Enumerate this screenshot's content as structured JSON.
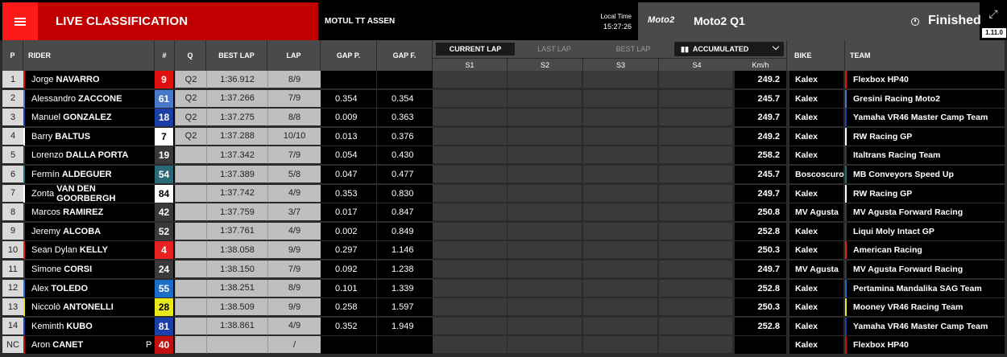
{
  "header": {
    "title": "LIVE CLASSIFICATION",
    "event": "MOTUL TT ASSEN",
    "local_time_label": "Local Time",
    "local_time": "15:27:26",
    "series_logo": "Moto2",
    "session": "Moto2 Q1",
    "status": "Finished",
    "version": "1.11.0"
  },
  "columns": {
    "pos": "P",
    "rider": "RIDER",
    "num": "#",
    "q": "Q",
    "best_lap": "BEST LAP",
    "lap": "LAP",
    "gap_p": "GAP P.",
    "gap_f": "GAP F.",
    "s1": "S1",
    "s2": "S2",
    "s3": "S3",
    "s4": "S4",
    "kmh": "Km/h",
    "bike": "BIKE",
    "team": "TEAM"
  },
  "tabs": [
    "CURRENT LAP",
    "LAST LAP",
    "BEST LAP"
  ],
  "mode_select": "ACCUMULATED",
  "rows": [
    {
      "pos": "1",
      "first": "Jorge",
      "last": "NAVARRO",
      "num": "9",
      "num_bg": "#e01010",
      "num_fg": "#ffffff",
      "accent": "#e01010",
      "q": "Q2",
      "best": "1:36.912",
      "lap": "8/9",
      "gap_p": "",
      "gap_f": "",
      "kmh": "249.2",
      "bike": "Kalex",
      "team": "Flexbox HP40",
      "flag": ""
    },
    {
      "pos": "2",
      "first": "Alessandro",
      "last": "ZACCONE",
      "num": "61",
      "num_bg": "#4a78c8",
      "num_fg": "#ffffff",
      "accent": "#4a78c8",
      "q": "Q2",
      "best": "1:37.266",
      "lap": "7/9",
      "gap_p": "0.354",
      "gap_f": "0.354",
      "kmh": "245.7",
      "bike": "Kalex",
      "team": "Gresini Racing Moto2",
      "flag": ""
    },
    {
      "pos": "3",
      "first": "Manuel",
      "last": "GONZALEZ",
      "num": "18",
      "num_bg": "#1a3fa8",
      "num_fg": "#ffffff",
      "accent": "#1a3fa8",
      "q": "Q2",
      "best": "1:37.275",
      "lap": "8/8",
      "gap_p": "0.009",
      "gap_f": "0.363",
      "kmh": "249.7",
      "bike": "Kalex",
      "team": "Yamaha VR46 Master Camp Team",
      "flag": ""
    },
    {
      "pos": "4",
      "first": "Barry",
      "last": "BALTUS",
      "num": "7",
      "num_bg": "#ffffff",
      "num_fg": "#000000",
      "accent": "#ffffff",
      "q": "Q2",
      "best": "1:37.288",
      "lap": "10/10",
      "gap_p": "0.013",
      "gap_f": "0.376",
      "kmh": "249.2",
      "bike": "Kalex",
      "team": "RW Racing GP",
      "flag": ""
    },
    {
      "pos": "5",
      "first": "Lorenzo",
      "last": "DALLA PORTA",
      "num": "19",
      "num_bg": "#3a3a3a",
      "num_fg": "#ffffff",
      "accent": "#3a3a3a",
      "q": "",
      "best": "1:37.342",
      "lap": "7/9",
      "gap_p": "0.054",
      "gap_f": "0.430",
      "kmh": "258.2",
      "bike": "Kalex",
      "team": "Italtrans Racing Team",
      "flag": ""
    },
    {
      "pos": "6",
      "first": "Fermín",
      "last": "ALDEGUER",
      "num": "54",
      "num_bg": "#2a6a78",
      "num_fg": "#ffffff",
      "accent": "#2a6a78",
      "q": "",
      "best": "1:37.389",
      "lap": "5/8",
      "gap_p": "0.047",
      "gap_f": "0.477",
      "kmh": "245.7",
      "bike": "Boscoscuro",
      "team": "MB Conveyors Speed Up",
      "flag": ""
    },
    {
      "pos": "7",
      "first": "Zonta",
      "last": "VAN DEN GOORBERGH",
      "num": "84",
      "num_bg": "#ffffff",
      "num_fg": "#000000",
      "accent": "#ffffff",
      "q": "",
      "best": "1:37.742",
      "lap": "4/9",
      "gap_p": "0.353",
      "gap_f": "0.830",
      "kmh": "249.7",
      "bike": "Kalex",
      "team": "RW Racing GP",
      "flag": ""
    },
    {
      "pos": "8",
      "first": "Marcos",
      "last": "RAMIREZ",
      "num": "42",
      "num_bg": "#3a3a3a",
      "num_fg": "#ffffff",
      "accent": "#3a3a3a",
      "q": "",
      "best": "1:37.759",
      "lap": "3/7",
      "gap_p": "0.017",
      "gap_f": "0.847",
      "kmh": "250.8",
      "bike": "MV Agusta",
      "team": "MV Agusta Forward Racing",
      "flag": ""
    },
    {
      "pos": "9",
      "first": "Jeremy",
      "last": "ALCOBA",
      "num": "52",
      "num_bg": "#3a3a3a",
      "num_fg": "#ffffff",
      "accent": "#3a3a3a",
      "q": "",
      "best": "1:37.761",
      "lap": "4/9",
      "gap_p": "0.002",
      "gap_f": "0.849",
      "kmh": "252.8",
      "bike": "Kalex",
      "team": "Liqui Moly Intact GP",
      "flag": ""
    },
    {
      "pos": "10",
      "first": "Sean Dylan",
      "last": "KELLY",
      "num": "4",
      "num_bg": "#e82020",
      "num_fg": "#ffffff",
      "accent": "#e82020",
      "q": "",
      "best": "1:38.058",
      "lap": "9/9",
      "gap_p": "0.297",
      "gap_f": "1.146",
      "kmh": "250.3",
      "bike": "Kalex",
      "team": "American Racing",
      "flag": ""
    },
    {
      "pos": "11",
      "first": "Simone",
      "last": "CORSI",
      "num": "24",
      "num_bg": "#3a3a3a",
      "num_fg": "#ffffff",
      "accent": "#3a3a3a",
      "q": "",
      "best": "1:38.150",
      "lap": "7/9",
      "gap_p": "0.092",
      "gap_f": "1.238",
      "kmh": "249.7",
      "bike": "MV Agusta",
      "team": "MV Agusta Forward Racing",
      "flag": ""
    },
    {
      "pos": "12",
      "first": "Alex",
      "last": "TOLEDO",
      "num": "55",
      "num_bg": "#1a6ec8",
      "num_fg": "#ffffff",
      "accent": "#1a6ec8",
      "q": "",
      "best": "1:38.251",
      "lap": "8/9",
      "gap_p": "0.101",
      "gap_f": "1.339",
      "kmh": "252.8",
      "bike": "Kalex",
      "team": "Pertamina Mandalika SAG Team",
      "flag": ""
    },
    {
      "pos": "13",
      "first": "Niccolò",
      "last": "ANTONELLI",
      "num": "28",
      "num_bg": "#e8e81a",
      "num_fg": "#000000",
      "accent": "#e8e81a",
      "q": "",
      "best": "1:38.509",
      "lap": "9/9",
      "gap_p": "0.258",
      "gap_f": "1.597",
      "kmh": "250.3",
      "bike": "Kalex",
      "team": "Mooney VR46 Racing Team",
      "flag": ""
    },
    {
      "pos": "14",
      "first": "Keminth",
      "last": "KUBO",
      "num": "81",
      "num_bg": "#1a3fa8",
      "num_fg": "#ffffff",
      "accent": "#1a3fa8",
      "q": "",
      "best": "1:38.861",
      "lap": "4/9",
      "gap_p": "0.352",
      "gap_f": "1.949",
      "kmh": "252.8",
      "bike": "Kalex",
      "team": "Yamaha VR46 Master Camp Team",
      "flag": ""
    },
    {
      "pos": "NC",
      "first": "Aron",
      "last": "CANET",
      "num": "40",
      "num_bg": "#c01010",
      "num_fg": "#ffffff",
      "accent": "#c01010",
      "q": "",
      "best": "",
      "lap": "/",
      "gap_p": "",
      "gap_f": "",
      "kmh": "",
      "bike": "Kalex",
      "team": "Flexbox HP40",
      "flag": "P"
    }
  ]
}
